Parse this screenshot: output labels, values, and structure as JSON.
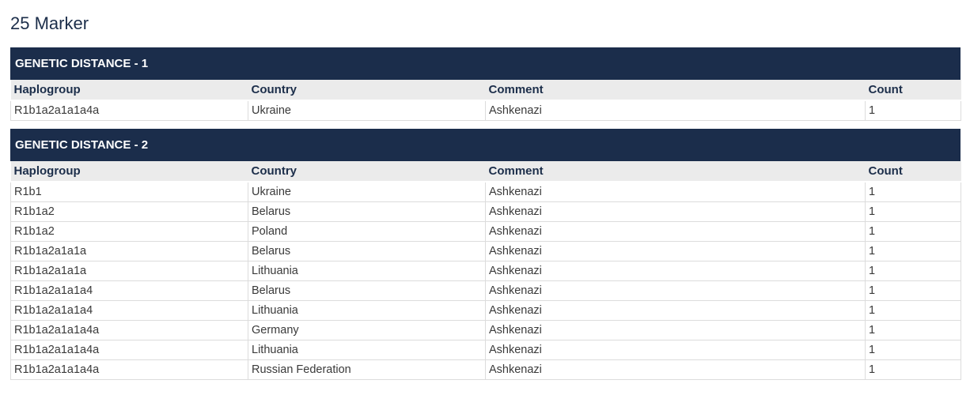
{
  "page": {
    "title": "25 Marker"
  },
  "columns": [
    "Haplogroup",
    "Country",
    "Comment",
    "Count"
  ],
  "sections": [
    {
      "header": "GENETIC DISTANCE - 1",
      "rows": [
        [
          "R1b1a2a1a1a4a",
          "Ukraine",
          "Ashkenazi",
          "1"
        ]
      ]
    },
    {
      "header": "GENETIC DISTANCE - 2",
      "rows": [
        [
          "R1b1",
          "Ukraine",
          "Ashkenazi",
          "1"
        ],
        [
          "R1b1a2",
          "Belarus",
          "Ashkenazi",
          "1"
        ],
        [
          "R1b1a2",
          "Poland",
          "Ashkenazi",
          "1"
        ],
        [
          "R1b1a2a1a1a",
          "Belarus",
          "Ashkenazi",
          "1"
        ],
        [
          "R1b1a2a1a1a",
          "Lithuania",
          "Ashkenazi",
          "1"
        ],
        [
          "R1b1a2a1a1a4",
          "Belarus",
          "Ashkenazi",
          "1"
        ],
        [
          "R1b1a2a1a1a4",
          "Lithuania",
          "Ashkenazi",
          "1"
        ],
        [
          "R1b1a2a1a1a4a",
          "Germany",
          "Ashkenazi",
          "1"
        ],
        [
          "R1b1a2a1a1a4a",
          "Lithuania",
          "Ashkenazi",
          "1"
        ],
        [
          "R1b1a2a1a1a4a",
          "Russian Federation",
          "Ashkenazi",
          "1"
        ]
      ]
    }
  ]
}
